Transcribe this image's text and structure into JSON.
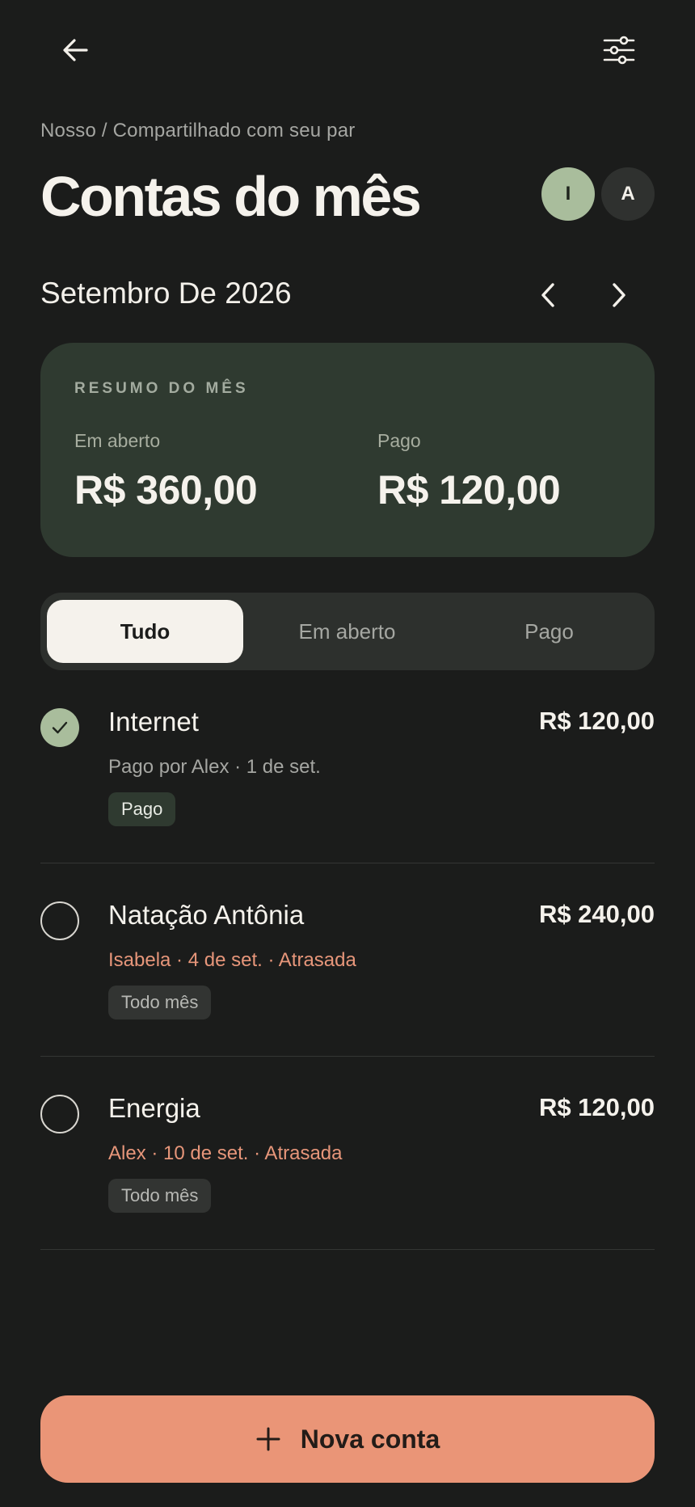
{
  "header": {
    "back_icon": "arrow-left-icon",
    "filter_icon": "sliders-icon",
    "breadcrumb": "Nosso / Compartilhado com seu par",
    "title": "Contas do mês",
    "avatars": [
      "I",
      "A"
    ]
  },
  "month": {
    "label": "Setembro De 2026",
    "prev_icon": "chevron-left-icon",
    "next_icon": "chevron-right-icon"
  },
  "summary": {
    "heading": "RESUMO DO MÊS",
    "open_label": "Em aberto",
    "open_value": "R$ 360,00",
    "paid_label": "Pago",
    "paid_value": "R$ 120,00"
  },
  "filters": {
    "tabs": [
      "Tudo",
      "Em aberto",
      "Pago"
    ],
    "selected": "Tudo"
  },
  "bills": [
    {
      "name": "Internet",
      "amount": "R$ 120,00",
      "meta": "Pago por Alex · 1 de set.",
      "badge": "Pago",
      "paid": true
    },
    {
      "name": "Natação Antônia",
      "amount": "R$ 240,00",
      "meta": "Isabela · 4 de set. · Atrasada",
      "badge": "Todo mês",
      "paid": false
    },
    {
      "name": "Energia",
      "amount": "R$ 120,00",
      "meta": "Alex · 10 de set. · Atrasada",
      "badge": "Todo mês",
      "paid": false
    }
  ],
  "cta": {
    "label": "Nova conta",
    "icon": "plus-icon"
  },
  "colors": {
    "background": "#1b1c1b",
    "card": "#2f3a30",
    "accent": "#ea9577",
    "sage": "#a9bd9c",
    "late": "#e7967a"
  }
}
